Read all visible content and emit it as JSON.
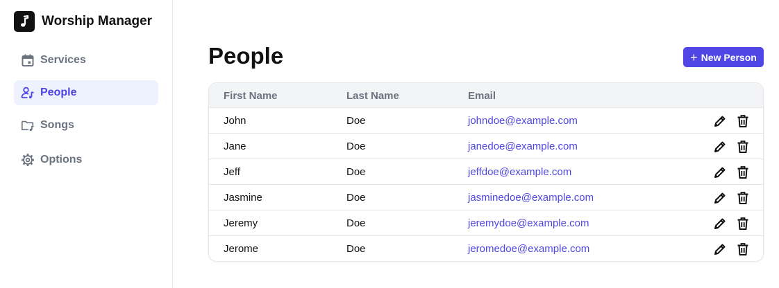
{
  "app": {
    "name": "Worship Manager",
    "logo_icon": "music-note-icon"
  },
  "sidebar": {
    "items": [
      {
        "label": "Services",
        "icon": "calendar-icon",
        "active": false
      },
      {
        "label": "People",
        "icon": "user-music-icon",
        "active": true
      },
      {
        "label": "Songs",
        "icon": "music-folder-icon",
        "active": false
      },
      {
        "label": "Options",
        "icon": "gear-icon",
        "active": false
      }
    ]
  },
  "main": {
    "title": "People",
    "new_button": {
      "label": "New Person",
      "icon": "plus-icon"
    },
    "table": {
      "headers": [
        "First Name",
        "Last Name",
        "Email"
      ],
      "rows": [
        {
          "first": "John",
          "last": "Doe",
          "email": "johndoe@example.com"
        },
        {
          "first": "Jane",
          "last": "Doe",
          "email": "janedoe@example.com"
        },
        {
          "first": "Jeff",
          "last": "Doe",
          "email": "jeffdoe@example.com"
        },
        {
          "first": "Jasmine",
          "last": "Doe",
          "email": "jasminedoe@example.com"
        },
        {
          "first": "Jeremy",
          "last": "Doe",
          "email": "jeremydoe@example.com"
        },
        {
          "first": "Jerome",
          "last": "Doe",
          "email": "jeromedoe@example.com"
        }
      ],
      "row_actions": [
        "pencil-icon",
        "trash-icon"
      ]
    }
  },
  "colors": {
    "accent": "#4f46e5",
    "active_bg": "#eef2ff",
    "muted": "#6b7280"
  }
}
